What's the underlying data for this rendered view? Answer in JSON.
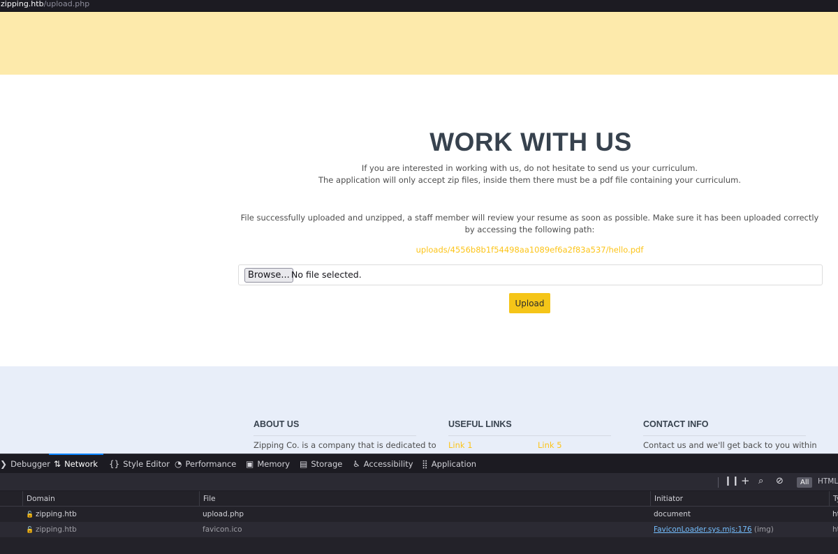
{
  "browser": {
    "url_host": "zipping.htb",
    "url_path": "/upload.php"
  },
  "page": {
    "title": "WORK WITH US",
    "intro_line1": "If you are interested in working with us, do not hesitate to send us your curriculum.",
    "intro_line2": "The application will only accept zip files, inside them there must be a pdf file containing your curriculum.",
    "success_message": "File successfully uploaded and unzipped, a staff member will review your resume as soon as possible. Make sure it has been uploaded correctly by accessing the following path:",
    "uploaded_path": "uploads/4556b8b1f54498aa1089ef6a2f83a537/hello.pdf",
    "browse_label": "Browse...",
    "no_file_text": "No file selected.",
    "upload_label": "Upload"
  },
  "footer": {
    "about_heading": "ABOUT US",
    "about_text": "Zipping Co. is a company that is dedicated to",
    "links_heading": "USEFUL LINKS",
    "link1": "Link 1",
    "link5": "Link 5",
    "contact_heading": "CONTACT INFO",
    "contact_text": "Contact us and we'll get back to you within"
  },
  "devtools": {
    "tabs": [
      "Debugger",
      "Network",
      "Style Editor",
      "Performance",
      "Memory",
      "Storage",
      "Accessibility",
      "Application"
    ],
    "active_tab": "Network",
    "filter_all": "All",
    "filter_html": "HTML",
    "columns": [
      "Domain",
      "File",
      "Initiator",
      "Ty"
    ],
    "requests": [
      {
        "domain": "zipping.htb",
        "file": "upload.php",
        "initiator": "document",
        "initiator_note": "",
        "type": "ht"
      },
      {
        "domain": "zipping.htb",
        "file": "favicon.ico",
        "initiator": "FaviconLoader.sys.mjs:176",
        "initiator_note": "(img)",
        "type": "ht"
      }
    ]
  },
  "colors": {
    "accent_yellow": "#fcc419",
    "banner_bg": "#fdeaab",
    "footer_bg": "#e8eef9",
    "devtools_bg": "#1c1b22",
    "devtools_active": "#0a84ff"
  }
}
